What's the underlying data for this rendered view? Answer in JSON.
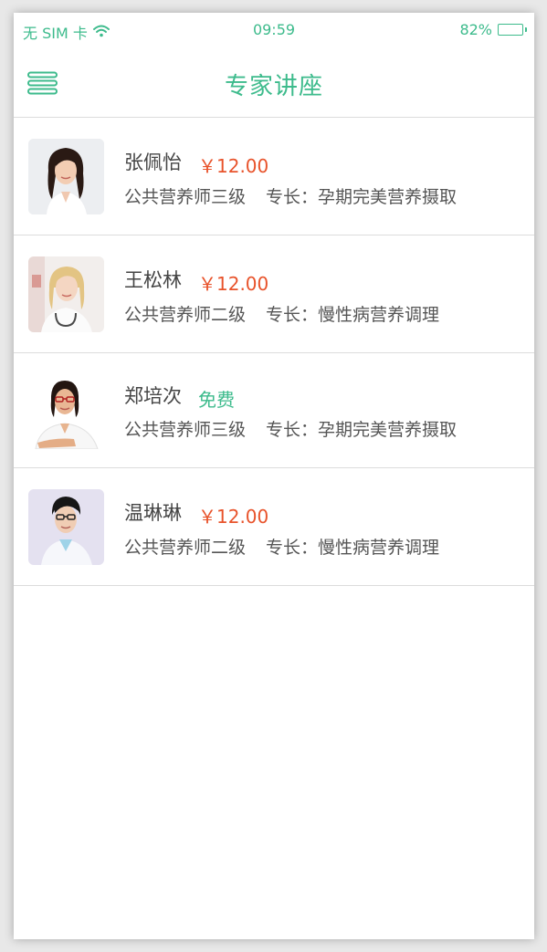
{
  "status_bar": {
    "carrier": "无 SIM 卡",
    "time": "09:59",
    "battery_percent": "82%",
    "battery_level": 0.82
  },
  "nav": {
    "title": "专家讲座",
    "menu_icon": "hamburger-menu-icon"
  },
  "colors": {
    "accent": "#3dbb8c",
    "price": "#e8532b"
  },
  "experts": [
    {
      "name": "张佩怡",
      "price": "￥12.00",
      "free": false,
      "title": "公共营养师三级",
      "specialty": "专长：孕期完美营养摄取"
    },
    {
      "name": "王松林",
      "price": "￥12.00",
      "free": false,
      "title": "公共营养师二级",
      "specialty": "专长：慢性病营养调理"
    },
    {
      "name": "郑培次",
      "price": "免费",
      "free": true,
      "title": "公共营养师三级",
      "specialty": "专长：孕期完美营养摄取"
    },
    {
      "name": "温琳琳",
      "price": "￥12.00",
      "free": false,
      "title": "公共营养师二级",
      "specialty": "专长：慢性病营养调理"
    }
  ]
}
